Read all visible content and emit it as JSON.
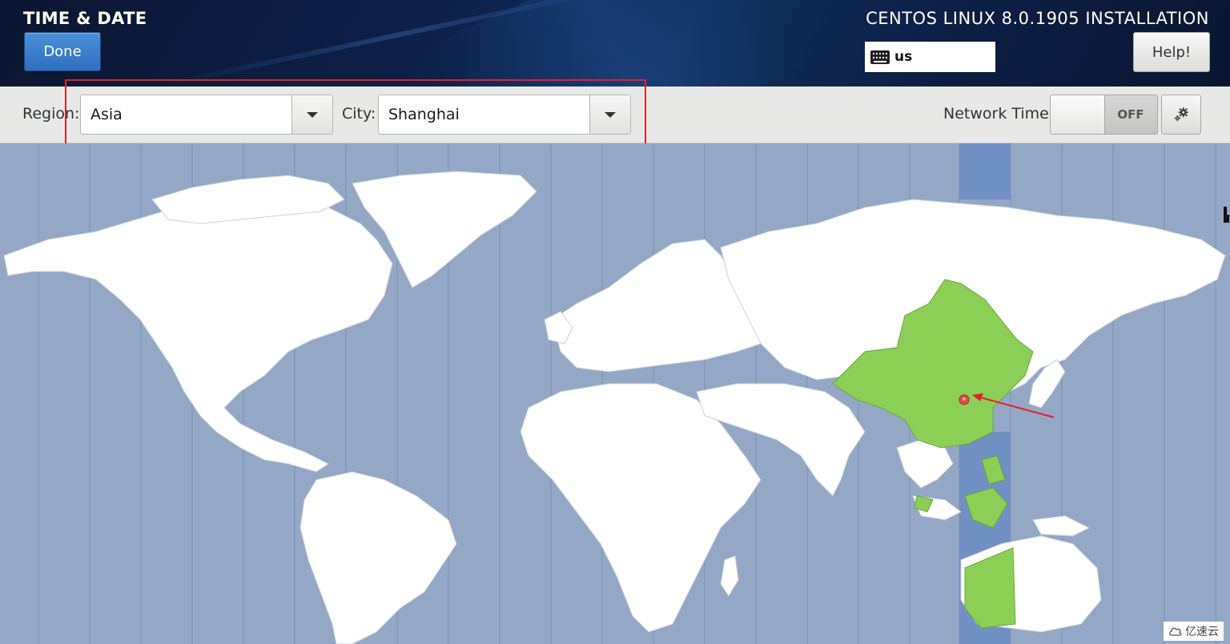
{
  "header": {
    "title": "TIME & DATE",
    "done_label": "Done",
    "install_title": "CENTOS LINUX 8.0.1905 INSTALLATION",
    "keyboard_layout": "us",
    "help_label": "Help!"
  },
  "toolbar": {
    "region_label": "Region:",
    "region_value": "Asia",
    "city_label": "City:",
    "city_value": "Shanghai",
    "network_time_label": "Network Time",
    "network_time_state": "OFF"
  },
  "map": {
    "selected_timezone_color": "#8ccf56",
    "active_band_color": "#7390c4",
    "ocean_color": "#94a8c6",
    "land_color": "#ffffff",
    "marker_color": "#e8464a"
  },
  "watermark": {
    "text": "亿速云"
  },
  "colors": {
    "annotation_red": "#e0232b",
    "done_blue": "#3a7fcf"
  }
}
